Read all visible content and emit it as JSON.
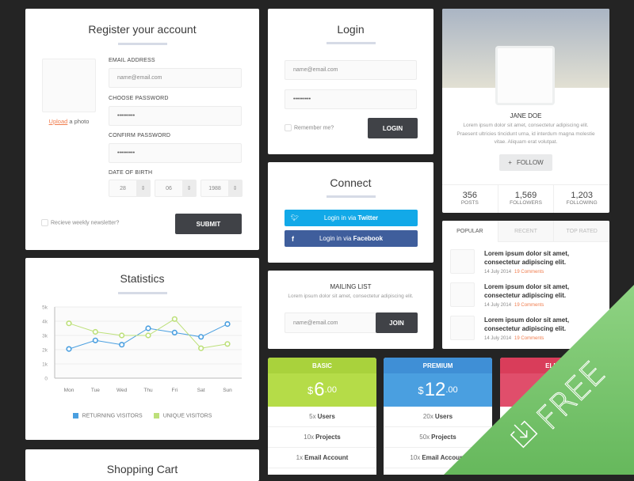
{
  "register": {
    "title": "Register your account",
    "upload_link": "Upload",
    "upload_text": " a photo",
    "email_label": "EMAIL ADDRESS",
    "email_placeholder": "name@email.com",
    "password_label": "CHOOSE PASSWORD",
    "password_value": "•••••••••",
    "confirm_label": "CONFIRM PASSWORD",
    "confirm_value": "•••••••••",
    "dob_label": "DATE OF BIRTH",
    "dob_day": "28",
    "dob_month": "06",
    "dob_year": "1988",
    "newsletter_label": "Recieve weekly newsletter?",
    "submit_label": "SUBMIT"
  },
  "login": {
    "title": "Login",
    "email_placeholder": "name@email.com",
    "password_value": "•••••••••",
    "remember_label": "Remember me?",
    "login_label": "LOGIN"
  },
  "connect": {
    "title": "Connect",
    "twitter_prefix": "Login in via ",
    "twitter_brand": "Twitter",
    "facebook_prefix": "Login in via ",
    "facebook_brand": "Facebook",
    "twitter_color": "#12a9e8",
    "facebook_color": "#3f5e9c"
  },
  "mailing": {
    "title": "MAILING LIST",
    "text": "Lorem ipsum dolor sit amet, consectetur adipiscing elit.",
    "email_placeholder": "name@email.com",
    "join_label": "JOIN"
  },
  "profile": {
    "name": "JANE DOE",
    "bio": "Lorem ipsum dolor sit amet, consectetur adipiscing elit. Praesent ultricies tincidunt urna, id interdum magna molestie vitae. Aliquam erat volutpat.",
    "follow_label": "FOLLOW",
    "stats": [
      {
        "value": "356",
        "label": "POSTS"
      },
      {
        "value": "1,569",
        "label": "FOLLOWERS"
      },
      {
        "value": "1,203",
        "label": "FOLLOWING"
      }
    ]
  },
  "posts": {
    "tabs": [
      "POPULAR",
      "RECENT",
      "TOP RATED"
    ],
    "active_tab": "POPULAR",
    "items": [
      {
        "title": "Lorem ipsum dolor sit amet, consectetur adipiscing elit.",
        "date": "14 July 2014",
        "comments": "19 Comments"
      },
      {
        "title": "Lorem ipsum dolor sit amet, consectetur adipiscing elit.",
        "date": "14 July 2014",
        "comments": "19 Comments"
      },
      {
        "title": "Lorem ipsum dolor sit amet, consectetur adipiscing elit.",
        "date": "14 July 2014",
        "comments": "19 Comments"
      }
    ]
  },
  "pricing": [
    {
      "name": "BASIC",
      "currency": "$",
      "amount": "6",
      "cents": ".00",
      "header_color": "#a9d23c",
      "price_color": "#b5dc48",
      "features": [
        {
          "qty": "5x",
          "item": "Users"
        },
        {
          "qty": "10x",
          "item": "Projects"
        },
        {
          "qty": "1x",
          "item": "Email Account"
        }
      ]
    },
    {
      "name": "PREMIUM",
      "currency": "$",
      "amount": "12",
      "cents": ".00",
      "header_color": "#3f8fd6",
      "price_color": "#4a9fe0",
      "features": [
        {
          "qty": "20x",
          "item": "Users"
        },
        {
          "qty": "50x",
          "item": "Projects"
        },
        {
          "qty": "10x",
          "item": "Email Account"
        }
      ]
    },
    {
      "name": "ELITE",
      "currency": "$",
      "amount": "",
      "cents": "",
      "header_color": "#d93d5a",
      "price_color": "#e04e6b",
      "features": []
    }
  ],
  "shopping_cart": {
    "title": "Shopping Cart"
  },
  "statistics": {
    "title": "Statistics"
  },
  "banner": {
    "label": "FREE",
    "color": "#74c069"
  },
  "chart_data": {
    "type": "line",
    "title": "Statistics",
    "categories": [
      "Mon",
      "Tue",
      "Wed",
      "Thu",
      "Fri",
      "Sat",
      "Sun"
    ],
    "series": [
      {
        "name": "RETURNING VISITORS",
        "color": "#4a9fe0",
        "values": [
          2050,
          2650,
          2350,
          3500,
          3200,
          2900,
          3800
        ]
      },
      {
        "name": "UNIQUE VISITORS",
        "color": "#bde07a",
        "values": [
          3850,
          3250,
          3000,
          3000,
          4150,
          2100,
          2400
        ]
      }
    ],
    "ylim": [
      0,
      5000
    ],
    "yticks": [
      "0",
      "1k",
      "2k",
      "3k",
      "4k",
      "5k"
    ],
    "grid": true,
    "legend": "bottom"
  }
}
